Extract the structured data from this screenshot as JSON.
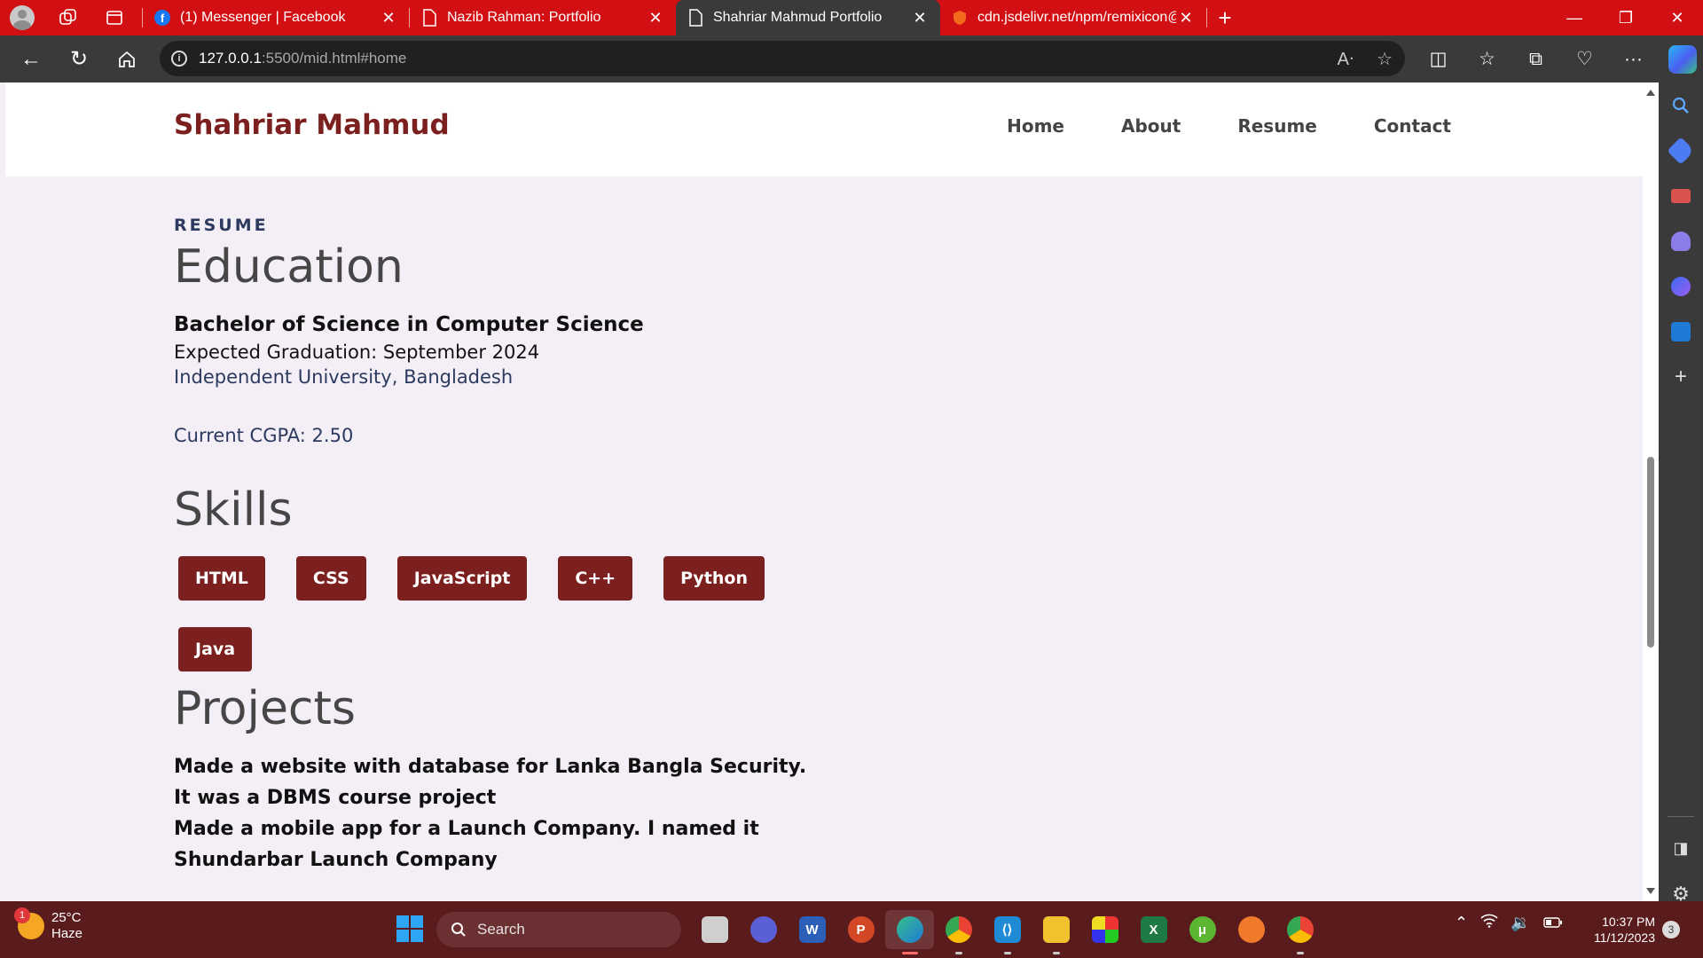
{
  "browser": {
    "tabs": [
      {
        "title": "(1) Messenger | Facebook",
        "icon": "facebook-icon",
        "active": false
      },
      {
        "title": "Nazib Rahman: Portfolio",
        "icon": "page-icon",
        "active": false
      },
      {
        "title": "Shahriar Mahmud Portfolio",
        "icon": "page-icon",
        "active": true
      },
      {
        "title": "cdn.jsdelivr.net/npm/remixicon@",
        "icon": "shield-favicon-icon",
        "active": false
      }
    ],
    "url_host": "127.0.0.1",
    "url_rest": ":5500/mid.html#home"
  },
  "site": {
    "brand": "Shahriar Mahmud",
    "nav": [
      "Home",
      "About",
      "Resume",
      "Contact"
    ]
  },
  "resume": {
    "eyebrow": "RESUME",
    "education_title": "Education",
    "degree": "Bachelor of Science in Computer Science",
    "graduation": "Expected Graduation: September 2024",
    "university": "Independent University, Bangladesh",
    "cgpa": "Current CGPA: 2.50",
    "skills_title": "Skills",
    "skills": [
      "HTML",
      "CSS",
      "JavaScript",
      "C++",
      "Python",
      "Java"
    ],
    "projects_title": "Projects",
    "projects": [
      "Made a website with database for Lanka Bangla Security.",
      "It was a DBMS course project",
      "Made a mobile app for a Launch Company. I named it",
      "Shundarbar Launch Company"
    ]
  },
  "taskbar": {
    "weather_temp": "25°C",
    "weather_cond": "Haze",
    "weather_badge": "1",
    "search_placeholder": "Search",
    "time": "10:37 PM",
    "date": "11/12/2023",
    "notifications": "3"
  },
  "colors": {
    "accent": "#7b1f1f",
    "tabbar": "#d20f13",
    "taskbar": "#5a1b1c",
    "page_bg": "#f4eef6"
  }
}
